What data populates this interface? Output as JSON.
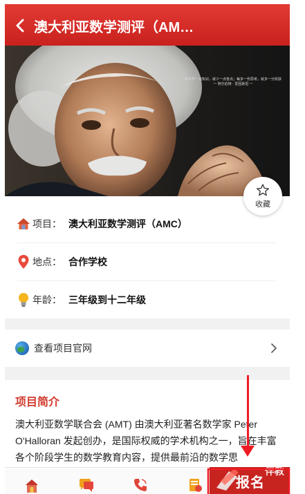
{
  "header": {
    "title": "澳大利亚数学测评（AMC）"
  },
  "hero": {
    "quote_lines": [
      "每多学一点知识，就少一点盲点；每多一份思考，就多一分收获",
      "一 阿尔伯特 · 爱因斯坦 一"
    ]
  },
  "favorite": {
    "label": "收藏"
  },
  "info": {
    "project": {
      "label": "项目：",
      "value": "澳大利亚数学测评（AMC）"
    },
    "location": {
      "label": "地点：",
      "value": "合作学校"
    },
    "age": {
      "label": "年龄：",
      "value": "三年级到十二年级"
    }
  },
  "official": {
    "label": "查看项目官网"
  },
  "intro": {
    "title": "项目简介",
    "text": "澳大利亚数学联合会 (AMT) 由澳大利亚著名数学家 Peter O'Halloran 发起创办，是国际权威的学术机构之一，旨在丰富各个阶段学生的数学教育内容，提供最前沿的数学思"
  },
  "tabbar": {
    "signup_label": "报名",
    "signup_badge": "伴教"
  },
  "colors": {
    "brand": "#c8201c",
    "title_accent": "#d23a2e",
    "annotation": "#ee1b24"
  }
}
